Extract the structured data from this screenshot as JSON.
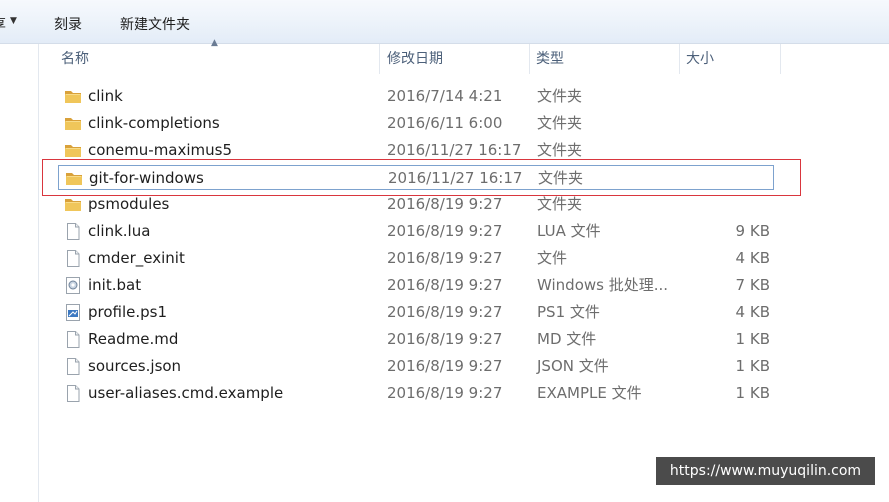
{
  "toolbar": {
    "left_cut_label": "享",
    "burn_label": "刻录",
    "new_folder_label": "新建文件夹"
  },
  "columns": {
    "name": "名称",
    "date": "修改日期",
    "type": "类型",
    "size": "大小"
  },
  "files": [
    {
      "name": "clink",
      "date": "2016/7/14 4:21",
      "type": "文件夹",
      "size": "",
      "icon": "folder-icon"
    },
    {
      "name": "clink-completions",
      "date": "2016/6/11 6:00",
      "type": "文件夹",
      "size": "",
      "icon": "folder-icon"
    },
    {
      "name": "conemu-maximus5",
      "date": "2016/11/27 16:17",
      "type": "文件夹",
      "size": "",
      "icon": "folder-icon"
    },
    {
      "name": "git-for-windows",
      "date": "2016/11/27 16:17",
      "type": "文件夹",
      "size": "",
      "icon": "folder-icon"
    },
    {
      "name": "psmodules",
      "date": "2016/8/19 9:27",
      "type": "文件夹",
      "size": "",
      "icon": "folder-icon"
    },
    {
      "name": "clink.lua",
      "date": "2016/8/19 9:27",
      "type": "LUA 文件",
      "size": "9 KB",
      "icon": "file-icon"
    },
    {
      "name": "cmder_exinit",
      "date": "2016/8/19 9:27",
      "type": "文件",
      "size": "4 KB",
      "icon": "file-icon"
    },
    {
      "name": "init.bat",
      "date": "2016/8/19 9:27",
      "type": "Windows 批处理...",
      "size": "7 KB",
      "icon": "batch-file-icon"
    },
    {
      "name": "profile.ps1",
      "date": "2016/8/19 9:27",
      "type": "PS1 文件",
      "size": "4 KB",
      "icon": "script-file-icon"
    },
    {
      "name": "Readme.md",
      "date": "2016/8/19 9:27",
      "type": "MD 文件",
      "size": "1 KB",
      "icon": "file-icon"
    },
    {
      "name": "sources.json",
      "date": "2016/8/19 9:27",
      "type": "JSON 文件",
      "size": "1 KB",
      "icon": "file-icon"
    },
    {
      "name": "user-aliases.cmd.example",
      "date": "2016/8/19 9:27",
      "type": "EXAMPLE 文件",
      "size": "1 KB",
      "icon": "file-icon"
    }
  ],
  "selected_index": 3,
  "watermark": "https://www.muyuqilin.com",
  "colors": {
    "highlight_border": "#d9363e",
    "selection_border": "#7da2ce",
    "folder": "#e8b84a"
  }
}
